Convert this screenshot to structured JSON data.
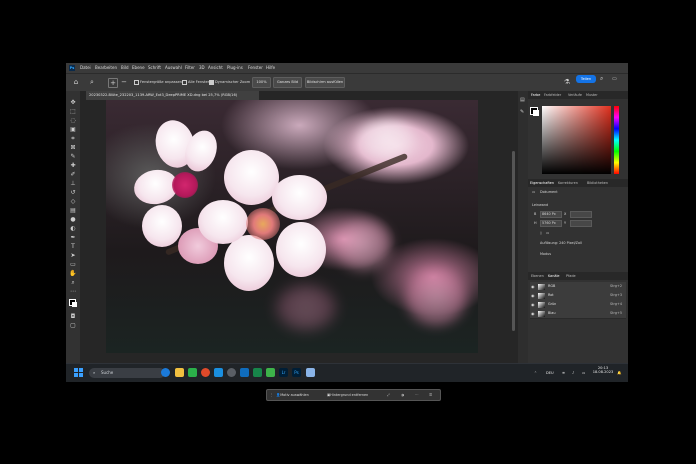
{
  "app": {
    "logo": "Ps",
    "accent": "#31a8ff",
    "share_color": "#1473e6"
  },
  "menu": {
    "items": [
      "Datei",
      "Bearbeiten",
      "Bild",
      "Ebene",
      "Schrift",
      "Auswahl",
      "Filter",
      "3D",
      "Ansicht",
      "Plug-ins",
      "Fenster",
      "Hilfe"
    ]
  },
  "options": {
    "resize_windows": "Fenstergröße anpassen",
    "all_windows": "Alle Fenster",
    "scrubby_zoom": "Dynamischer Zoom",
    "zoom_100": "100%",
    "fit_screen": "Ganzes Bild",
    "fill_screen": "Bildschirm ausfüllen",
    "share": "Teilen"
  },
  "document": {
    "tab_title": "20230322-Blüte_232203_1139-ARW_Ext3_DeepPRIME XD.dng bei 25,7% (RGB/16)",
    "zoom": "25,77%",
    "size": "8640 Px x 5760 Px (240 ppi)"
  },
  "context_bar": {
    "select_subject": "Motiv auswählen",
    "remove_bg": "Hintergrund entfernen"
  },
  "panels": {
    "color_tabs": [
      "Farbe",
      "Farbfelder",
      "Verläufe",
      "Muster"
    ],
    "props_tabs": [
      "Eigenschaften",
      "Korrekturen",
      "Bibliotheken"
    ],
    "props_doc": "Dokument",
    "canvas_title": "Leinwand",
    "width_label": "B",
    "width_value": "8640 Px",
    "height_label": "H",
    "height_value": "5760 Px",
    "x_label": "X",
    "y_label": "Y",
    "resolution": "Auflösung: 240 Pixel/Zoll",
    "mode": "Modus",
    "layers_tabs": [
      "Ebenen",
      "Kanäle",
      "Pfade"
    ],
    "channels": [
      {
        "name": "RGB",
        "shortcut": "Strg+2"
      },
      {
        "name": "Rot",
        "shortcut": "Strg+3"
      },
      {
        "name": "Grün",
        "shortcut": "Strg+4"
      },
      {
        "name": "Blau",
        "shortcut": "Strg+5"
      }
    ]
  },
  "taskbar": {
    "search_placeholder": "Suche",
    "language": "DEU",
    "time": "20:13",
    "date": "18.08.2023"
  }
}
